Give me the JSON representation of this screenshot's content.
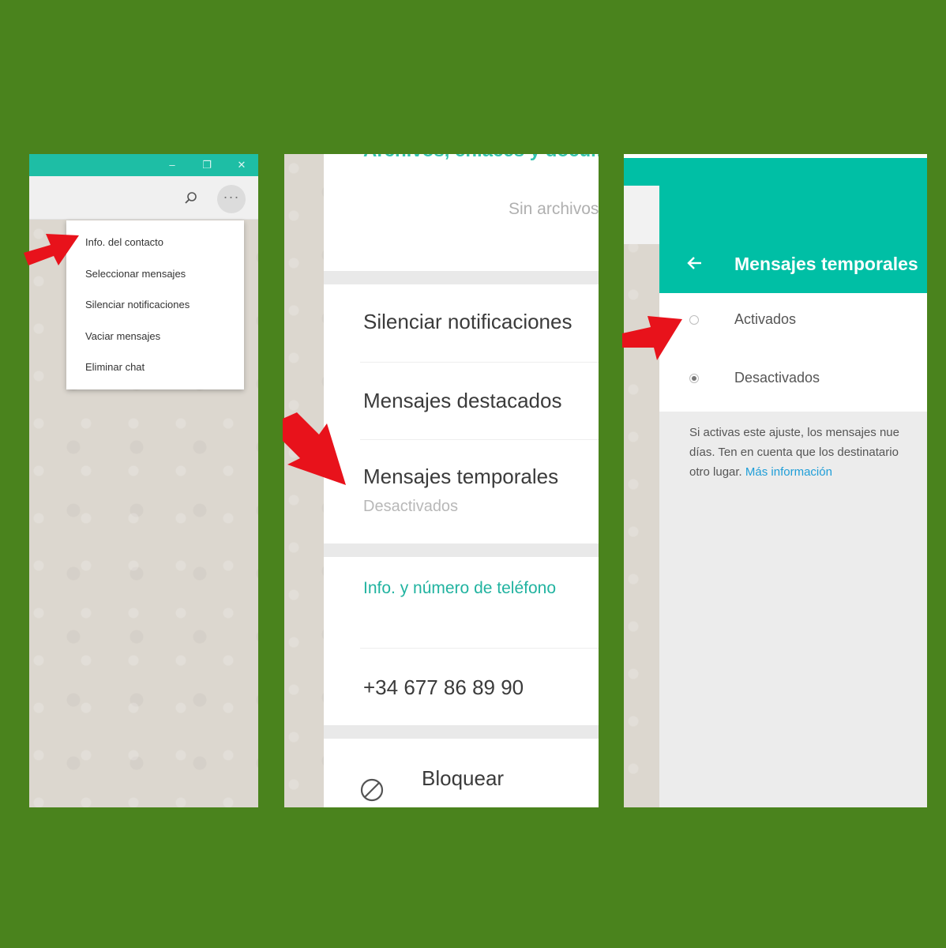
{
  "panel1": {
    "window_controls": [
      "–",
      "❐",
      "✕"
    ],
    "more_button": "···",
    "menu": [
      "Info. del contacto",
      "Seleccionar mensajes",
      "Silenciar notificaciones",
      "Vaciar mensajes",
      "Eliminar chat"
    ]
  },
  "panel2": {
    "partial_heading": "Archivos, enlaces y documentos",
    "no_files": "Sin archivos",
    "mute": "Silenciar notificaciones",
    "starred": "Mensajes destacados",
    "temporary": "Mensajes temporales",
    "temporary_status": "Desactivados",
    "info_heading": "Info. y número de teléfono",
    "phone": "+34 677 86 89 90",
    "block": "Bloquear"
  },
  "panel3": {
    "title": "Mensajes temporales",
    "option_on": "Activados",
    "option_off": "Desactivados",
    "selected": "Desactivados",
    "description_lines": [
      "Si activas este ajuste, los mensajes nue",
      "días. Ten en cuenta que los destinatario",
      "otro lugar."
    ],
    "more_info_link": "Más información"
  },
  "colors": {
    "background": "#4a831d",
    "teal": "#00bfa5",
    "arrow": "#e8121b",
    "link": "#1f9ed8"
  }
}
